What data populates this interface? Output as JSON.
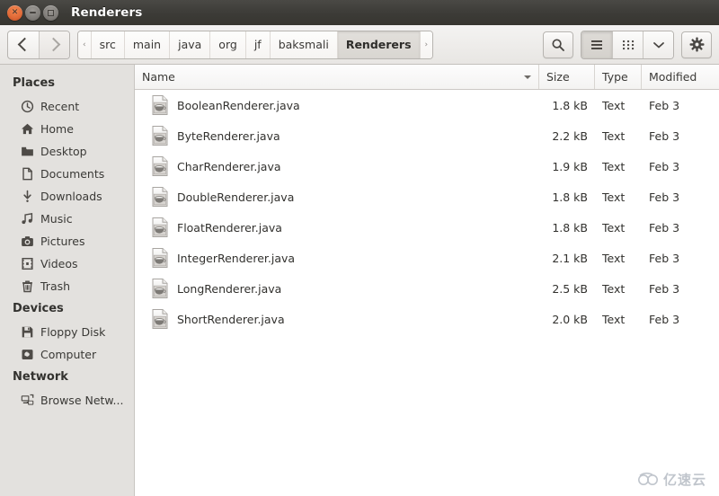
{
  "window": {
    "title": "Renderers",
    "controls": [
      {
        "name": "close",
        "glyph": "×"
      },
      {
        "name": "minimize",
        "glyph": "–"
      },
      {
        "name": "maximize",
        "glyph": "□"
      }
    ]
  },
  "toolbar": {
    "back_label": "Back",
    "forward_label": "Forward",
    "breadcrumbs": [
      {
        "label": "‹",
        "type": "arrow-left",
        "active": false
      },
      {
        "label": "src",
        "type": "crumb",
        "active": false
      },
      {
        "label": "main",
        "type": "crumb",
        "active": false
      },
      {
        "label": "java",
        "type": "crumb",
        "active": false
      },
      {
        "label": "org",
        "type": "crumb",
        "active": false
      },
      {
        "label": "jf",
        "type": "crumb",
        "active": false
      },
      {
        "label": "baksmali",
        "type": "crumb",
        "active": false
      },
      {
        "label": "Renderers",
        "type": "crumb",
        "active": true
      },
      {
        "label": "›",
        "type": "arrow-right",
        "active": false
      }
    ],
    "search_label": "Search",
    "view_list_label": "List view",
    "view_grid_label": "Icon view",
    "view_menu_label": "View options",
    "settings_label": "Settings"
  },
  "sidebar": {
    "sections": [
      {
        "heading": "Places",
        "items": [
          {
            "label": "Recent",
            "icon": "clock-icon"
          },
          {
            "label": "Home",
            "icon": "home-icon"
          },
          {
            "label": "Desktop",
            "icon": "folder-icon"
          },
          {
            "label": "Documents",
            "icon": "document-icon"
          },
          {
            "label": "Downloads",
            "icon": "download-icon"
          },
          {
            "label": "Music",
            "icon": "music-icon"
          },
          {
            "label": "Pictures",
            "icon": "camera-icon"
          },
          {
            "label": "Videos",
            "icon": "film-icon"
          },
          {
            "label": "Trash",
            "icon": "trash-icon"
          }
        ]
      },
      {
        "heading": "Devices",
        "items": [
          {
            "label": "Floppy Disk",
            "icon": "floppy-icon"
          },
          {
            "label": "Computer",
            "icon": "computer-icon"
          }
        ]
      },
      {
        "heading": "Network",
        "items": [
          {
            "label": "Browse Netw...",
            "icon": "network-icon"
          }
        ]
      }
    ]
  },
  "file_list": {
    "columns": [
      "Name",
      "Size",
      "Type",
      "Modified"
    ],
    "sort_column": "Name",
    "sort_direction": "descending-caret",
    "rows": [
      {
        "name": "BooleanRenderer.java",
        "size": "1.8 kB",
        "type": "Text",
        "modified": "Feb 3",
        "icon": "java-file-icon"
      },
      {
        "name": "ByteRenderer.java",
        "size": "2.2 kB",
        "type": "Text",
        "modified": "Feb 3",
        "icon": "java-file-icon"
      },
      {
        "name": "CharRenderer.java",
        "size": "1.9 kB",
        "type": "Text",
        "modified": "Feb 3",
        "icon": "java-file-icon"
      },
      {
        "name": "DoubleRenderer.java",
        "size": "1.8 kB",
        "type": "Text",
        "modified": "Feb 3",
        "icon": "java-file-icon"
      },
      {
        "name": "FloatRenderer.java",
        "size": "1.8 kB",
        "type": "Text",
        "modified": "Feb 3",
        "icon": "java-file-icon"
      },
      {
        "name": "IntegerRenderer.java",
        "size": "2.1 kB",
        "type": "Text",
        "modified": "Feb 3",
        "icon": "java-file-icon"
      },
      {
        "name": "LongRenderer.java",
        "size": "2.5 kB",
        "type": "Text",
        "modified": "Feb 3",
        "icon": "java-file-icon"
      },
      {
        "name": "ShortRenderer.java",
        "size": "2.0 kB",
        "type": "Text",
        "modified": "Feb 3",
        "icon": "java-file-icon"
      }
    ]
  },
  "watermark": {
    "text": "亿速云"
  },
  "colors": {
    "titlebar": "#3c3b37",
    "toolbar": "#eeecea",
    "sidebar": "#e3e1de",
    "list_background": "#ffffff",
    "close_button": "#e06a38",
    "text": "#32312e"
  }
}
